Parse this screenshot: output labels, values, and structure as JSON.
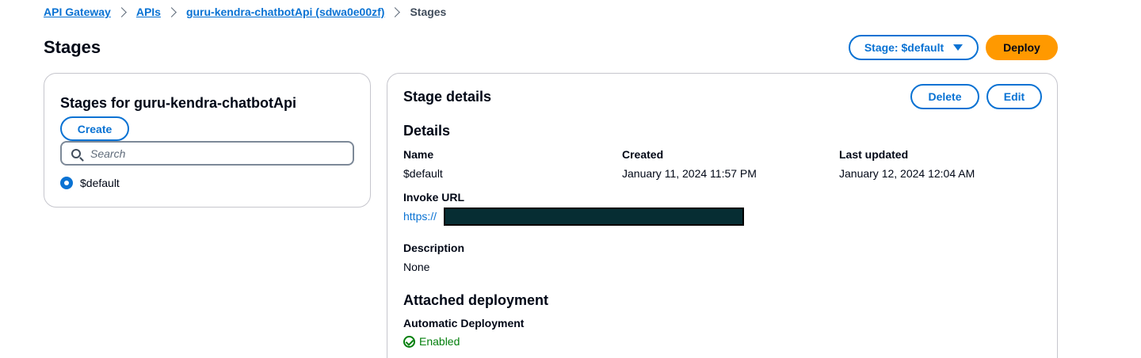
{
  "breadcrumb": {
    "items": [
      "API Gateway",
      "APIs",
      "guru-kendra-chatbotApi (sdwa0e00zf)"
    ],
    "current": "Stages"
  },
  "page": {
    "title": "Stages"
  },
  "header": {
    "stage_select_label": "Stage: $default",
    "deploy_label": "Deploy"
  },
  "stages_panel": {
    "title": "Stages for guru-kendra-chatbotApi",
    "create_label": "Create",
    "search_placeholder": "Search",
    "stages": [
      {
        "label": "$default",
        "selected": true
      }
    ]
  },
  "stage_details": {
    "title": "Stage details",
    "delete_label": "Delete",
    "edit_label": "Edit",
    "details_heading": "Details",
    "name_label": "Name",
    "name_value": "$default",
    "created_label": "Created",
    "created_value": "January 11, 2024 11:57 PM",
    "updated_label": "Last updated",
    "updated_value": "January 12, 2024 12:04 AM",
    "invoke_url_label": "Invoke URL",
    "invoke_url_prefix": "https://",
    "description_label": "Description",
    "description_value": "None",
    "attached_heading": "Attached deployment",
    "auto_deploy_label": "Automatic Deployment",
    "auto_deploy_value": "Enabled"
  },
  "colors": {
    "link": "#0972d3",
    "primary_button": "#ff9900",
    "success": "#037f0c",
    "redaction": "#062d33"
  }
}
